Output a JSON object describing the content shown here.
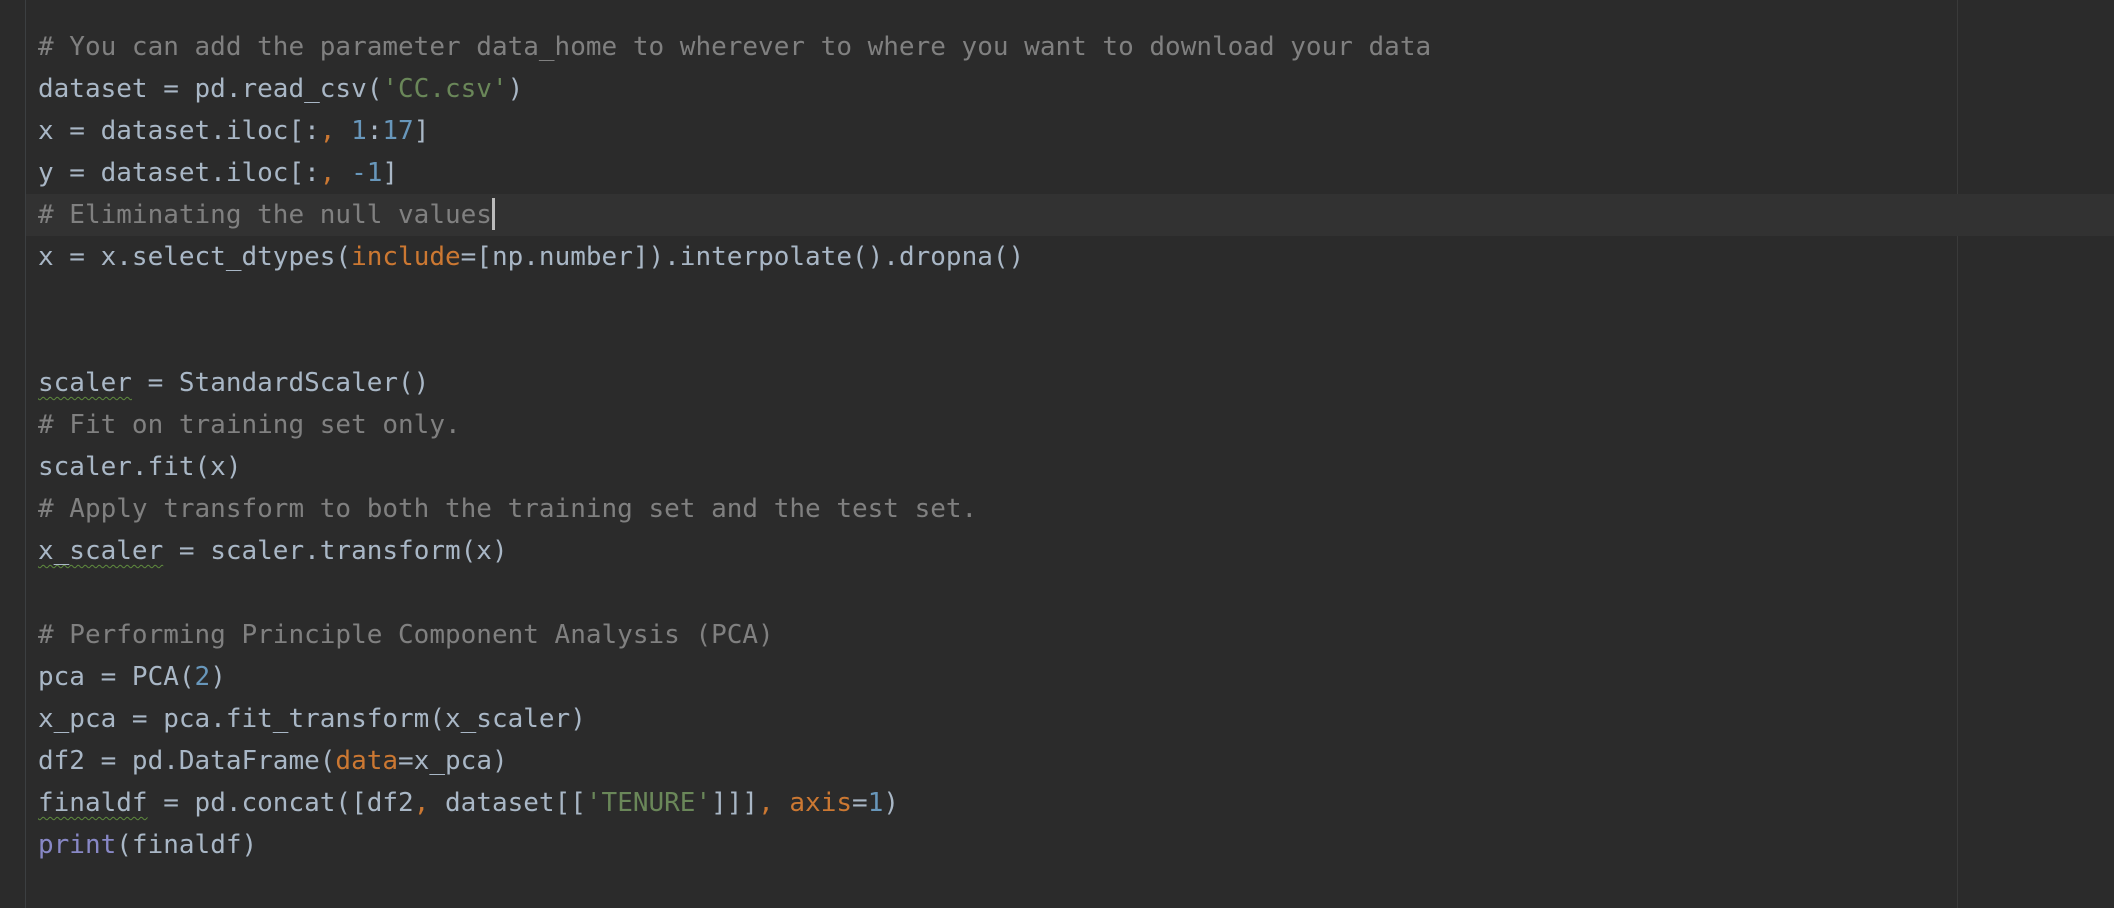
{
  "colors": {
    "background": "#2b2b2b",
    "current_line": "#323232",
    "default_text": "#a9b7c6",
    "comment": "#808080",
    "string": "#6a8759",
    "number": "#6897bb",
    "keyword_param": "#cc7832",
    "builtin": "#8888c6",
    "warning_underline": "#5f8b3e"
  },
  "editor": {
    "cursor_line": 5,
    "lines": [
      [
        {
          "t": "# You can add the parameter data_home to wherever to where you want to download your data",
          "k": "comment"
        }
      ],
      [
        {
          "t": "dataset = pd.read_csv(",
          "k": "default"
        },
        {
          "t": "'CC.csv'",
          "k": "string"
        },
        {
          "t": ")",
          "k": "default"
        }
      ],
      [
        {
          "t": "x = dataset.iloc[:",
          "k": "default"
        },
        {
          "t": ", ",
          "k": "punct"
        },
        {
          "t": "1",
          "k": "number"
        },
        {
          "t": ":",
          "k": "default"
        },
        {
          "t": "17",
          "k": "number"
        },
        {
          "t": "]",
          "k": "default"
        }
      ],
      [
        {
          "t": "y = dataset.iloc[:",
          "k": "default"
        },
        {
          "t": ", ",
          "k": "punct"
        },
        {
          "t": "-1",
          "k": "number"
        },
        {
          "t": "]",
          "k": "default"
        }
      ],
      [
        {
          "t": "# Eliminating the null values",
          "k": "comment"
        }
      ],
      [
        {
          "t": "x = x.select_dtypes(",
          "k": "default"
        },
        {
          "t": "include",
          "k": "param"
        },
        {
          "t": "=[np.number]).interpolate().dropna()",
          "k": "default"
        }
      ],
      [],
      [],
      [
        {
          "t": "scaler",
          "k": "warn"
        },
        {
          "t": " = StandardScaler()",
          "k": "default"
        }
      ],
      [
        {
          "t": "# Fit on training set only.",
          "k": "comment"
        }
      ],
      [
        {
          "t": "scaler.fit(x)",
          "k": "default"
        }
      ],
      [
        {
          "t": "# Apply transform to both the training set and the test set.",
          "k": "comment"
        }
      ],
      [
        {
          "t": "x_scaler",
          "k": "warn"
        },
        {
          "t": " = scaler.transform(x)",
          "k": "default"
        }
      ],
      [],
      [
        {
          "t": "# Performing Principle Component Analysis (PCA)",
          "k": "comment"
        }
      ],
      [
        {
          "t": "pca = PCA(",
          "k": "default"
        },
        {
          "t": "2",
          "k": "number"
        },
        {
          "t": ")",
          "k": "default"
        }
      ],
      [
        {
          "t": "x_pca = pca.fit_transform(x_scaler)",
          "k": "default"
        }
      ],
      [
        {
          "t": "df2 = pd.DataFrame(",
          "k": "default"
        },
        {
          "t": "data",
          "k": "param"
        },
        {
          "t": "=x_pca)",
          "k": "default"
        }
      ],
      [
        {
          "t": "finaldf",
          "k": "warn"
        },
        {
          "t": " = pd.concat([df2",
          "k": "default"
        },
        {
          "t": ", ",
          "k": "punct"
        },
        {
          "t": "dataset[[",
          "k": "default"
        },
        {
          "t": "'TENURE'",
          "k": "string"
        },
        {
          "t": "]]]",
          "k": "default"
        },
        {
          "t": ", ",
          "k": "punct"
        },
        {
          "t": "axis",
          "k": "param"
        },
        {
          "t": "=",
          "k": "default"
        },
        {
          "t": "1",
          "k": "number"
        },
        {
          "t": ")",
          "k": "default"
        }
      ],
      [
        {
          "t": "print",
          "k": "builtin"
        },
        {
          "t": "(finaldf)",
          "k": "default"
        }
      ]
    ]
  }
}
